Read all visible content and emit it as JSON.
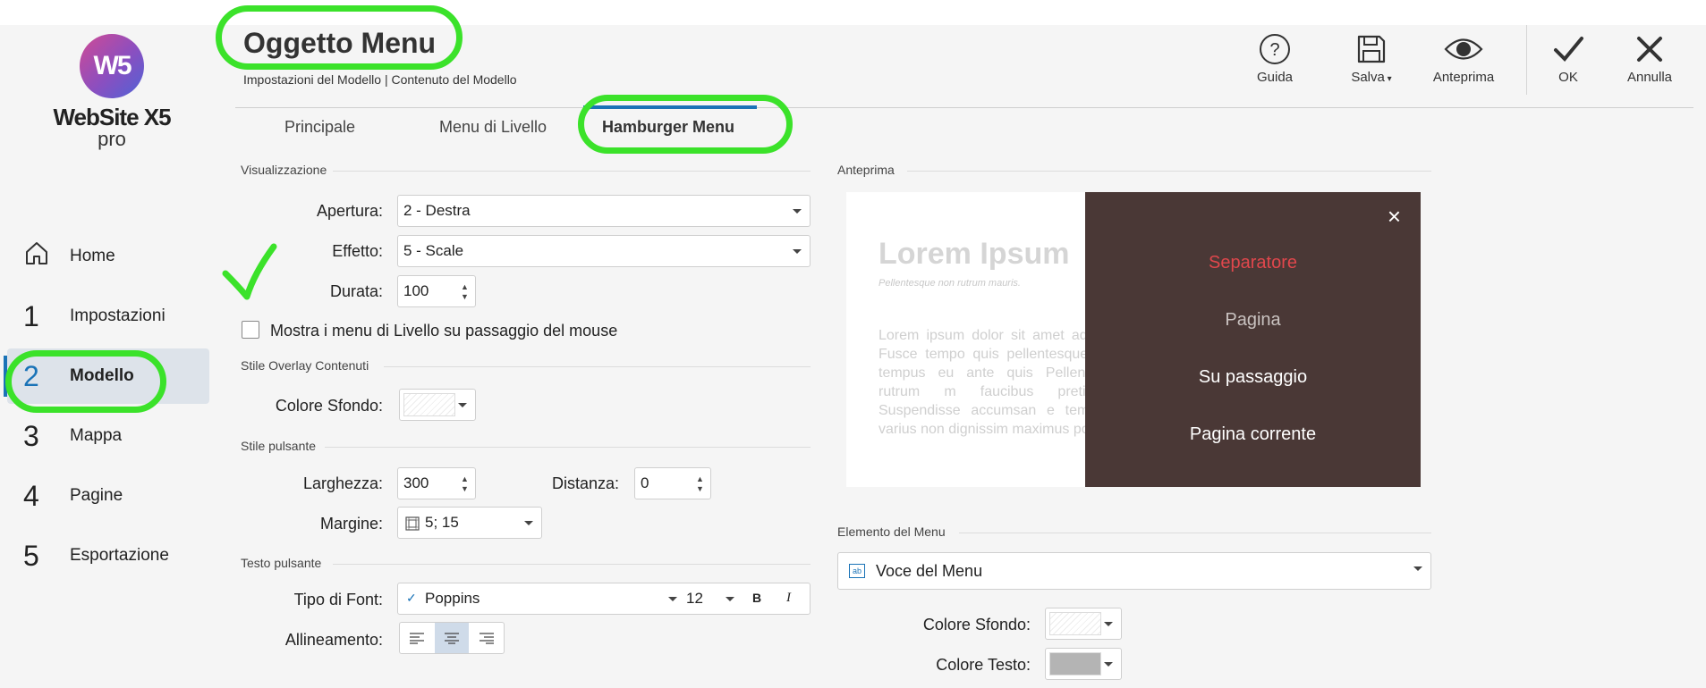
{
  "app": {
    "logo_initials": "W5",
    "logo_name": "WebSite X5",
    "logo_edition": "pro"
  },
  "sidebar": {
    "items": [
      {
        "num": "",
        "label": "Home"
      },
      {
        "num": "1",
        "label": "Impostazioni"
      },
      {
        "num": "2",
        "label": "Modello"
      },
      {
        "num": "3",
        "label": "Mappa"
      },
      {
        "num": "4",
        "label": "Pagine"
      },
      {
        "num": "5",
        "label": "Esportazione"
      }
    ],
    "active_index": 2
  },
  "header": {
    "title": "Oggetto Menu",
    "breadcrumb": "Impostazioni del Modello | Contenuto del Modello",
    "toolbar": [
      {
        "label": "Guida",
        "icon": "help-icon"
      },
      {
        "label": "Salva",
        "icon": "save-icon"
      },
      {
        "label": "Anteprima",
        "icon": "eye-icon"
      },
      {
        "label": "OK",
        "icon": "check-icon"
      },
      {
        "label": "Annulla",
        "icon": "close-icon"
      }
    ]
  },
  "tabs": [
    {
      "label": "Principale"
    },
    {
      "label": "Menu di Livello"
    },
    {
      "label": "Hamburger Menu",
      "active": true
    }
  ],
  "visualizzazione": {
    "section": "Visualizzazione",
    "apertura_label": "Apertura:",
    "apertura_value": "2 - Destra",
    "effetto_label": "Effetto:",
    "effetto_value": "5 - Scale",
    "durata_label": "Durata:",
    "durata_value": "100",
    "mostra_label": "Mostra i menu di Livello su passaggio del mouse",
    "mostra_checked": false
  },
  "overlay": {
    "section": "Stile Overlay Contenuti",
    "colore_label": "Colore Sfondo:"
  },
  "pulsante": {
    "section": "Stile pulsante",
    "larghezza_label": "Larghezza:",
    "larghezza_value": "300",
    "distanza_label": "Distanza:",
    "distanza_value": "0",
    "margine_label": "Margine:",
    "margine_value": "5; 15"
  },
  "testo": {
    "section": "Testo pulsante",
    "font_label": "Tipo di Font:",
    "font_value": "Poppins",
    "font_size": "12",
    "bold": "B",
    "italic": "I",
    "allineamento_label": "Allineamento:",
    "alignment": "center"
  },
  "anteprima": {
    "section": "Anteprima",
    "heading": "Lorem Ipsum",
    "subheading": "Pellentesque non rutrum mauris.",
    "body": "Lorem ipsum dolor sit amet adipiscing elit. Fusce tempo quis pellentesque nisi auctor tempus eu ante quis Pellentesque non rutrum m faucibus pretium turpis Suspendisse accumsan e tempus sapien varius non dignissim maximus porttitor",
    "close_glyph": "×",
    "menu_items": [
      {
        "label": "Separatore",
        "color": "#e0474c"
      },
      {
        "label": "Pagina",
        "color": "#c9c2c0"
      },
      {
        "label": "Su passaggio",
        "color": "#ffffff"
      },
      {
        "label": "Pagina corrente",
        "color": "#ffffff"
      }
    ],
    "panel_color": "#4a3836"
  },
  "elemento": {
    "section": "Elemento del Menu",
    "value": "Voce del Menu",
    "icon_text": "ab",
    "sfondo_label": "Colore Sfondo:",
    "testo_label": "Colore Testo:"
  },
  "colors": {
    "accent": "#1a73b7",
    "annotation": "#3be22a"
  }
}
